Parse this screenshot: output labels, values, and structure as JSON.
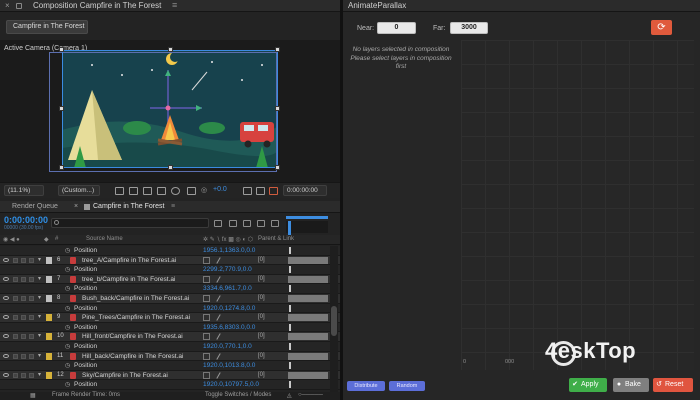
{
  "composition_panel": {
    "tab_title": "Composition Campfire in The Forest",
    "chip_label": "Campfire in The Forest",
    "camera_label": "Active Camera (Camera 1)"
  },
  "viewer_toolbar": {
    "zoom": "(11.1%)",
    "resolution": "(Custom...)",
    "exposure": "+0.0",
    "timecode": "0:00:00:00"
  },
  "timeline": {
    "tab_render_queue": "Render Queue",
    "tab_comp": "Campfire in The Forest",
    "current_time": "0:00:00:00",
    "fps": "00000 (30.00 fps)",
    "col_number": "#",
    "col_source": "Source Name",
    "col_parent": "Parent & Link",
    "rows": [
      {
        "kind": "prop",
        "name": "Position",
        "value": "1956.1,1363.0,0.0"
      },
      {
        "kind": "layer",
        "num": "6",
        "name": "tree_A/Campfire in The Forest.ai"
      },
      {
        "kind": "prop",
        "name": "Position",
        "value": "2299.2,770.9,0.0"
      },
      {
        "kind": "layer",
        "num": "7",
        "name": "tree_b/Campfire in The Forest.ai"
      },
      {
        "kind": "prop",
        "name": "Position",
        "value": "3334.6,961.7,0.0"
      },
      {
        "kind": "layer",
        "num": "8",
        "name": "Bush_back/Campfire in The Forest.ai"
      },
      {
        "kind": "prop",
        "name": "Position",
        "value": "1920.0,1274.8,0.0"
      },
      {
        "kind": "layer",
        "num": "9",
        "name": "Pine_Trees/Campfire in The Forest.ai"
      },
      {
        "kind": "prop",
        "name": "Position",
        "value": "1935.6,8303.0,0.0"
      },
      {
        "kind": "layer",
        "num": "10",
        "name": "Hill_front/Campfire in The Forest.ai"
      },
      {
        "kind": "prop",
        "name": "Position",
        "value": "1920.0,770.1,0.0"
      },
      {
        "kind": "layer",
        "num": "11",
        "name": "Hill_back/Campfire in The Forest.ai"
      },
      {
        "kind": "prop",
        "name": "Position",
        "value": "1920.0,1013.8,0.0"
      },
      {
        "kind": "layer",
        "num": "12",
        "name": "Sky/Campfire in The Forest.ai"
      },
      {
        "kind": "prop",
        "name": "Position",
        "value": "1920.0,10797.5,0.0"
      }
    ],
    "parent_value": "[0]",
    "footer_render": "Frame Render Time: 0ms",
    "footer_toggle": "Toggle Switches / Modes"
  },
  "animate_parallax": {
    "tab_title": "AnimateParallax",
    "near_label": "Near:",
    "near_value": "0",
    "far_label": "Far:",
    "far_value": "3000",
    "message": "No layers selected in composition Please select layers in composition first",
    "ruler_start": "0",
    "ruler_mid": "000",
    "distribute_label": "Distribute",
    "random_label": "Random",
    "apply_label": "Apply",
    "bake_label": "Bake",
    "reset_label": "Reset",
    "colors": {
      "apply": "#3fae49",
      "bake": "#7f7f7f",
      "reset": "#e0553f",
      "refresh": "#e05a3c",
      "small": "#5c6ed8"
    }
  },
  "watermark": "4eskTop"
}
